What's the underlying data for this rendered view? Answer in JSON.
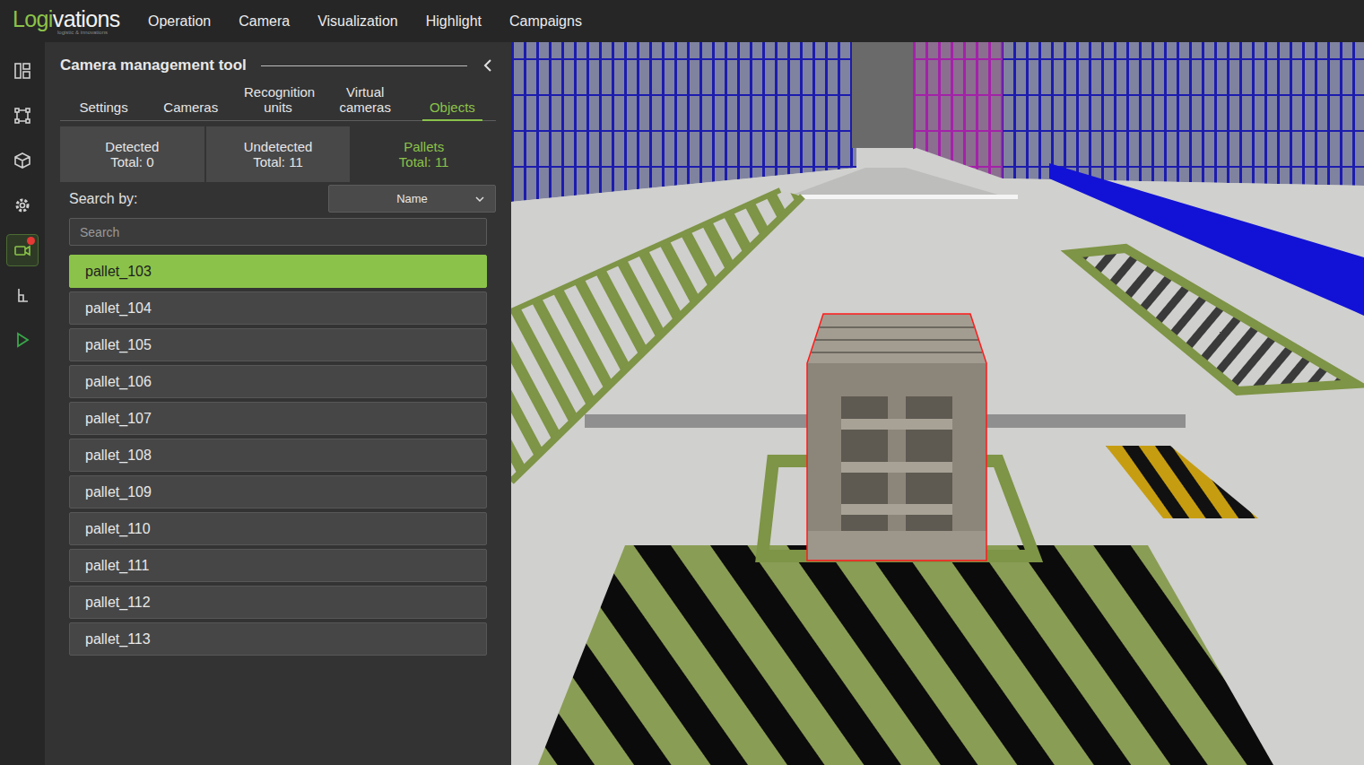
{
  "logo": {
    "prefix": "Logi",
    "suffix": "vations",
    "tagline": "logistic & innovations"
  },
  "menu": [
    "Operation",
    "Camera",
    "Visualization",
    "Highlight",
    "Campaigns"
  ],
  "rail": [
    {
      "selected": false,
      "alert": false
    },
    {
      "selected": false,
      "alert": false
    },
    {
      "selected": false,
      "alert": false
    },
    {
      "selected": false,
      "alert": false
    },
    {
      "selected": true,
      "alert": true
    },
    {
      "selected": false,
      "alert": false
    },
    {
      "selected": false,
      "alert": false
    }
  ],
  "panel": {
    "title": "Camera management tool",
    "tabs": [
      {
        "label": "Settings",
        "selected": false
      },
      {
        "label": "Cameras",
        "selected": false
      },
      {
        "label": "Recognition units",
        "selected": false
      },
      {
        "label": "Virtual cameras",
        "selected": false
      },
      {
        "label": "Objects",
        "selected": true
      }
    ],
    "subtabs": [
      {
        "label": "Detected",
        "total": "Total: 0",
        "selected": false
      },
      {
        "label": "Undetected",
        "total": "Total: 11",
        "selected": false
      },
      {
        "label": "Pallets",
        "total": "Total: 11",
        "selected": true
      }
    ],
    "search": {
      "label": "Search by:",
      "field": "Name",
      "placeholder": "Search"
    },
    "objects": [
      {
        "name": "pallet_103",
        "selected": true
      },
      {
        "name": "pallet_104",
        "selected": false
      },
      {
        "name": "pallet_105",
        "selected": false
      },
      {
        "name": "pallet_106",
        "selected": false
      },
      {
        "name": "pallet_107",
        "selected": false
      },
      {
        "name": "pallet_108",
        "selected": false
      },
      {
        "name": "pallet_109",
        "selected": false
      },
      {
        "name": "pallet_110",
        "selected": false
      },
      {
        "name": "pallet_111",
        "selected": false
      },
      {
        "name": "pallet_112",
        "selected": false
      },
      {
        "name": "pallet_113",
        "selected": false
      }
    ]
  }
}
